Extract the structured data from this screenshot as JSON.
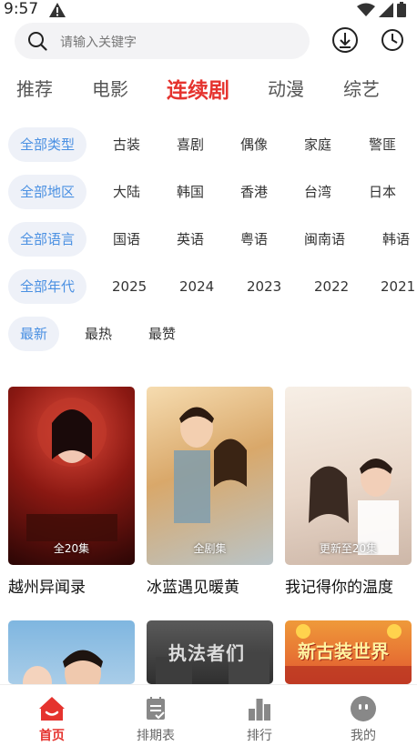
{
  "status_bar": {
    "time": "9:57"
  },
  "search": {
    "placeholder": "请输入关键字"
  },
  "category_tabs": [
    {
      "label": "推荐",
      "active": false
    },
    {
      "label": "电影",
      "active": false
    },
    {
      "label": "连续剧",
      "active": true
    },
    {
      "label": "动漫",
      "active": false
    },
    {
      "label": "综艺",
      "active": false
    }
  ],
  "filters": {
    "type": [
      "全部类型",
      "古装",
      "喜剧",
      "偶像",
      "家庭",
      "警匪"
    ],
    "region": [
      "全部地区",
      "大陆",
      "韩国",
      "香港",
      "台湾",
      "日本"
    ],
    "language": [
      "全部语言",
      "国语",
      "英语",
      "粤语",
      "闽南语",
      "韩语"
    ],
    "year": [
      "全部年代",
      "2025",
      "2024",
      "2023",
      "2022",
      "2021"
    ],
    "sort": [
      "最新",
      "最热",
      "最赞"
    ]
  },
  "shows": [
    {
      "title": "越州异闻录",
      "badge": "全20集",
      "poster_text": "越州异闻录"
    },
    {
      "title": "冰蓝遇见暖黄",
      "badge": "全剧集",
      "poster_text": "冰蓝遇见暖黄"
    },
    {
      "title": "我记得你的温度",
      "badge": "更新至20集",
      "poster_text": "我记得你的温度"
    },
    {
      "title": "",
      "badge": "",
      "poster_text": ""
    },
    {
      "title": "",
      "badge": "",
      "poster_text": "执法者们"
    },
    {
      "title": "",
      "badge": "",
      "poster_text": "新古装世界"
    }
  ],
  "bottom_nav": [
    {
      "label": "首页",
      "icon": "home-icon",
      "active": true
    },
    {
      "label": "排期表",
      "icon": "schedule-icon",
      "active": false
    },
    {
      "label": "排行",
      "icon": "ranking-icon",
      "active": false
    },
    {
      "label": "我的",
      "icon": "profile-icon",
      "active": false
    }
  ],
  "colors": {
    "accent": "#e5332e",
    "chip_active_text": "#4a90e2",
    "chip_active_bg": "#eef1f8"
  }
}
